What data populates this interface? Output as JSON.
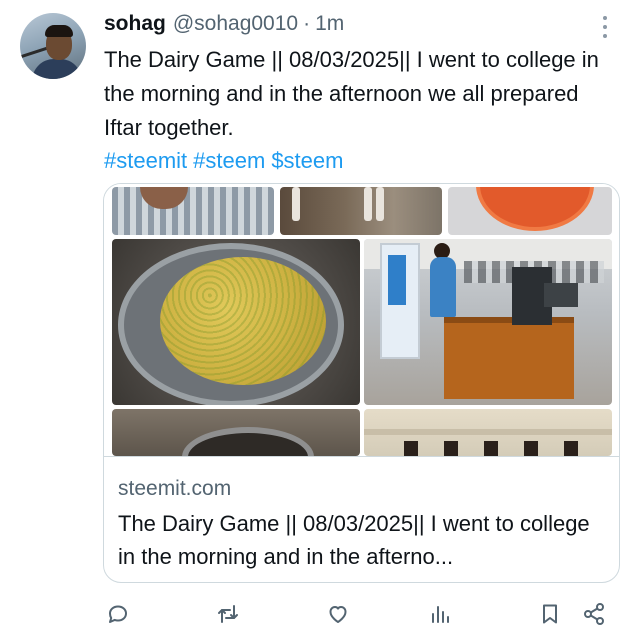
{
  "post": {
    "author_name": "sohag",
    "author_handle": "@sohag0010",
    "separator": "·",
    "time": "1m",
    "text": "The Dairy Game ||  08/03/2025|| I went to college in the morning and in the afternoon we all prepared Iftar together.",
    "hashtags": [
      "#steemit",
      "#steem",
      "$steem"
    ]
  },
  "link_card": {
    "domain": "steemit.com",
    "title": "The Dairy Game || 08/03/2025|| I went to college in the morning and in the afterno..."
  },
  "icons": {
    "more": "more-vertical-icon",
    "reply": "reply-icon",
    "repost": "repost-icon",
    "like": "like-icon",
    "views": "views-icon",
    "bookmark": "bookmark-icon",
    "share": "share-icon"
  },
  "colors": {
    "link": "#1d9bf0",
    "secondary_text": "#536471",
    "icon": "#536471",
    "border": "#cfd9de"
  }
}
